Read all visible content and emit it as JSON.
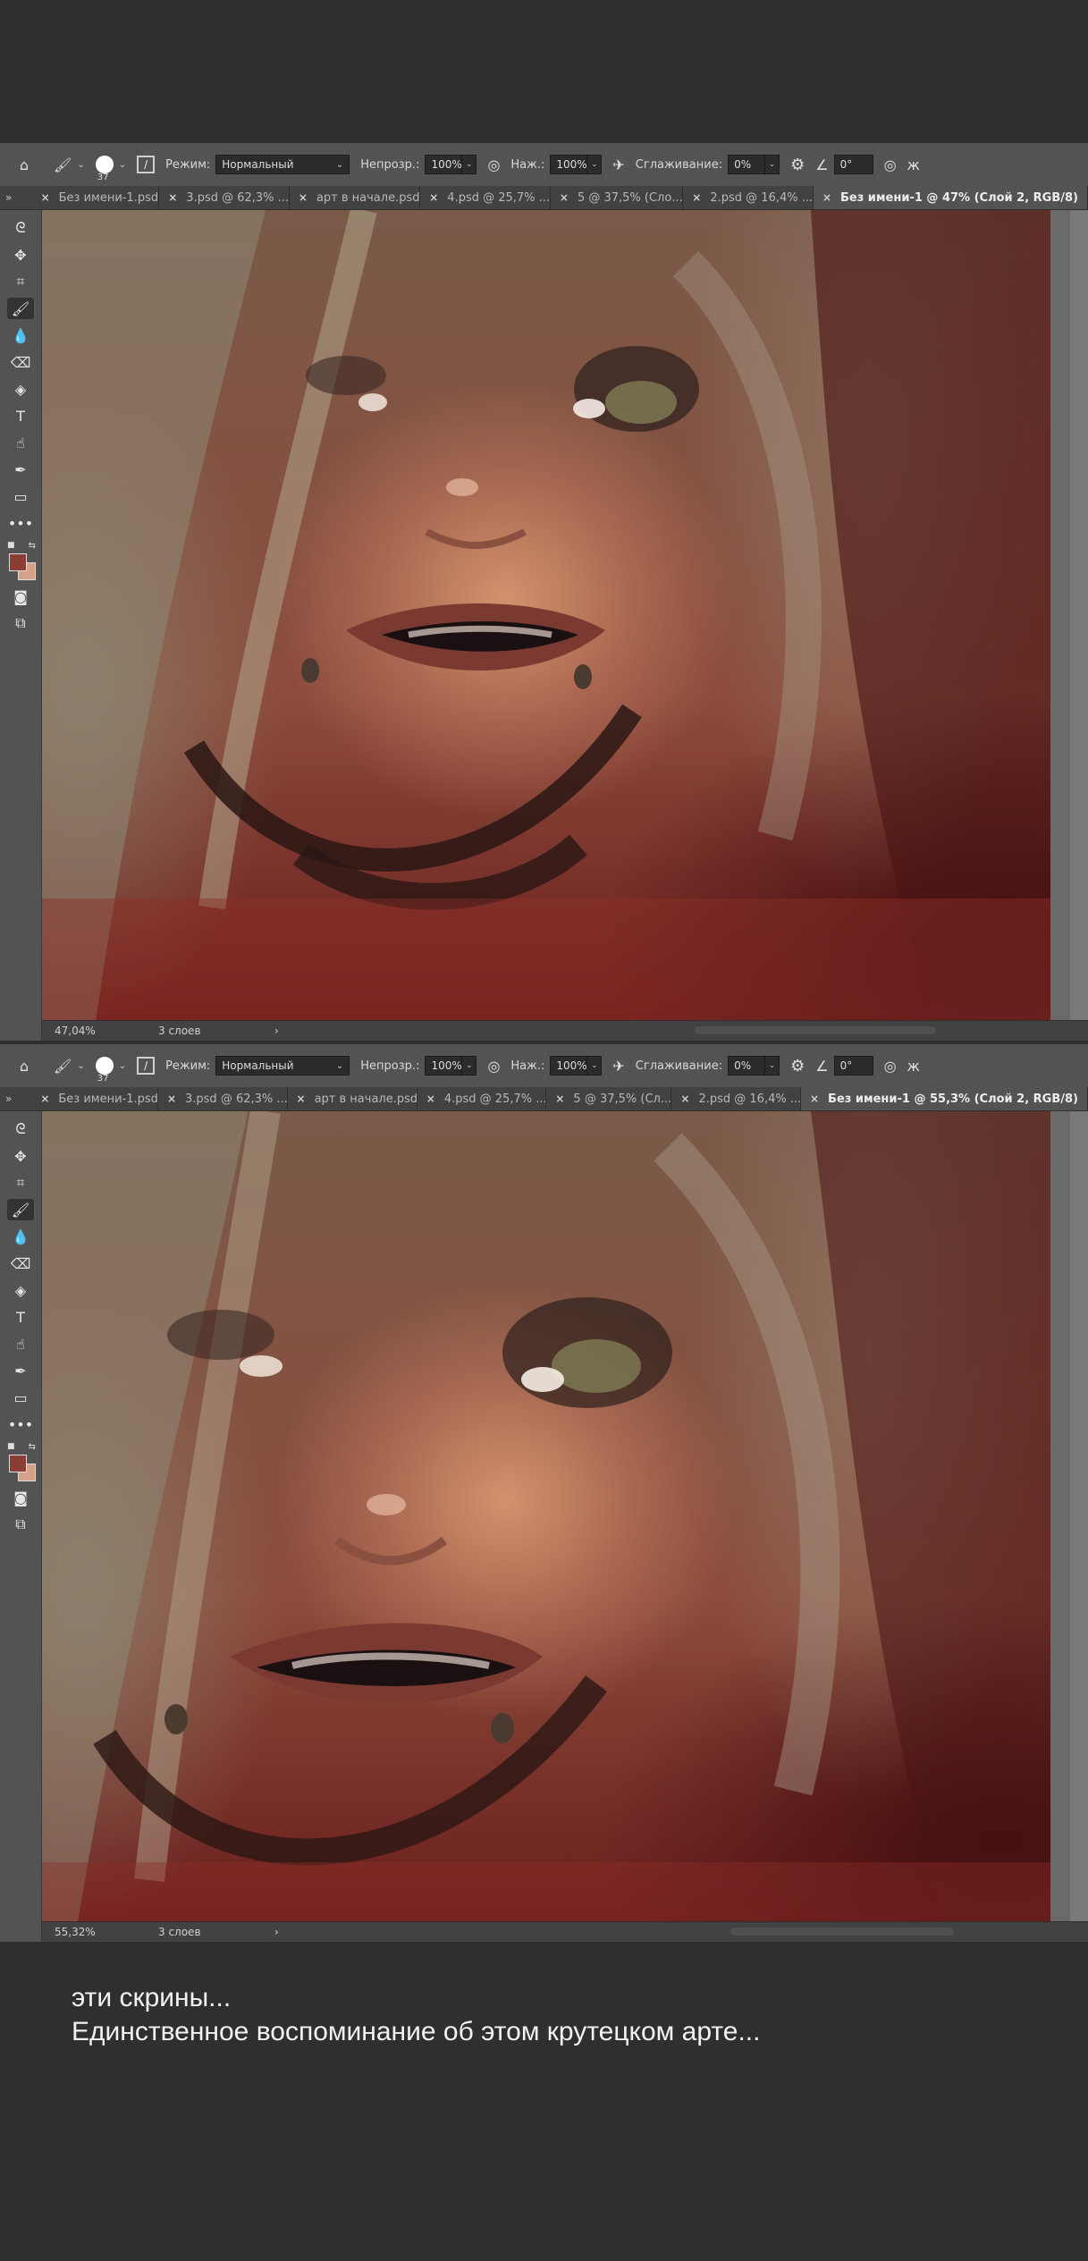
{
  "windows": [
    {
      "options": {
        "brush_size": "37",
        "mode_label": "Режим:",
        "mode_value": "Нормальный",
        "opacity_label": "Непрозр.:",
        "opacity_value": "100%",
        "pressure_label": "Наж.:",
        "pressure_value": "100%",
        "smoothing_label": "Сглаживание:",
        "smoothing_value": "0%",
        "angle_value": "0°"
      },
      "tabs": [
        {
          "label": "Без имени-1.psd",
          "active": false
        },
        {
          "label": "3.psd @ 62,3% ...",
          "active": false
        },
        {
          "label": "арт в начале.psd",
          "active": false
        },
        {
          "label": "4.psd @ 25,7% ...",
          "active": false
        },
        {
          "label": "5 @ 37,5% (Сло...",
          "active": false
        },
        {
          "label": "2.psd @ 16,4% ...",
          "active": false
        },
        {
          "label": "Без имени-1 @ 47% (Слой 2, RGB/8)",
          "active": true
        }
      ],
      "status": {
        "zoom": "47,04%",
        "layers": "3 слоев",
        "arrow": "›"
      }
    },
    {
      "options": {
        "brush_size": "37",
        "mode_label": "Режим:",
        "mode_value": "Нормальный",
        "opacity_label": "Непрозр.:",
        "opacity_value": "100%",
        "pressure_label": "Наж.:",
        "pressure_value": "100%",
        "smoothing_label": "Сглаживание:",
        "smoothing_value": "0%",
        "angle_value": "0°"
      },
      "tabs": [
        {
          "label": "Без имени-1.psd",
          "active": false
        },
        {
          "label": "3.psd @ 62,3% ...",
          "active": false
        },
        {
          "label": "арт в начале.psd",
          "active": false
        },
        {
          "label": "4.psd @ 25,7% ...",
          "active": false
        },
        {
          "label": "5 @ 37,5% (Сл...",
          "active": false
        },
        {
          "label": "2.psd @ 16,4% ...",
          "active": false
        },
        {
          "label": "Без имени-1 @ 55,3% (Слой 2, RGB/8)",
          "active": true
        }
      ],
      "status": {
        "zoom": "55,32%",
        "layers": "3 слоев",
        "arrow": "›"
      }
    }
  ],
  "colors": {
    "foreground": "#8a3d32",
    "background": "#d7a08a",
    "ui_panel": "#535353",
    "page_bg": "#2f2f2f"
  },
  "icons": {
    "home": "home-icon",
    "brush": "brush-icon",
    "airbrush": "airbrush-icon",
    "gear": "gear-icon",
    "symmetry": "butterfly-icon"
  },
  "caption": {
    "line1": "эти скрины...",
    "line2": "Единственное воспоминание об этом крутецком арте..."
  }
}
